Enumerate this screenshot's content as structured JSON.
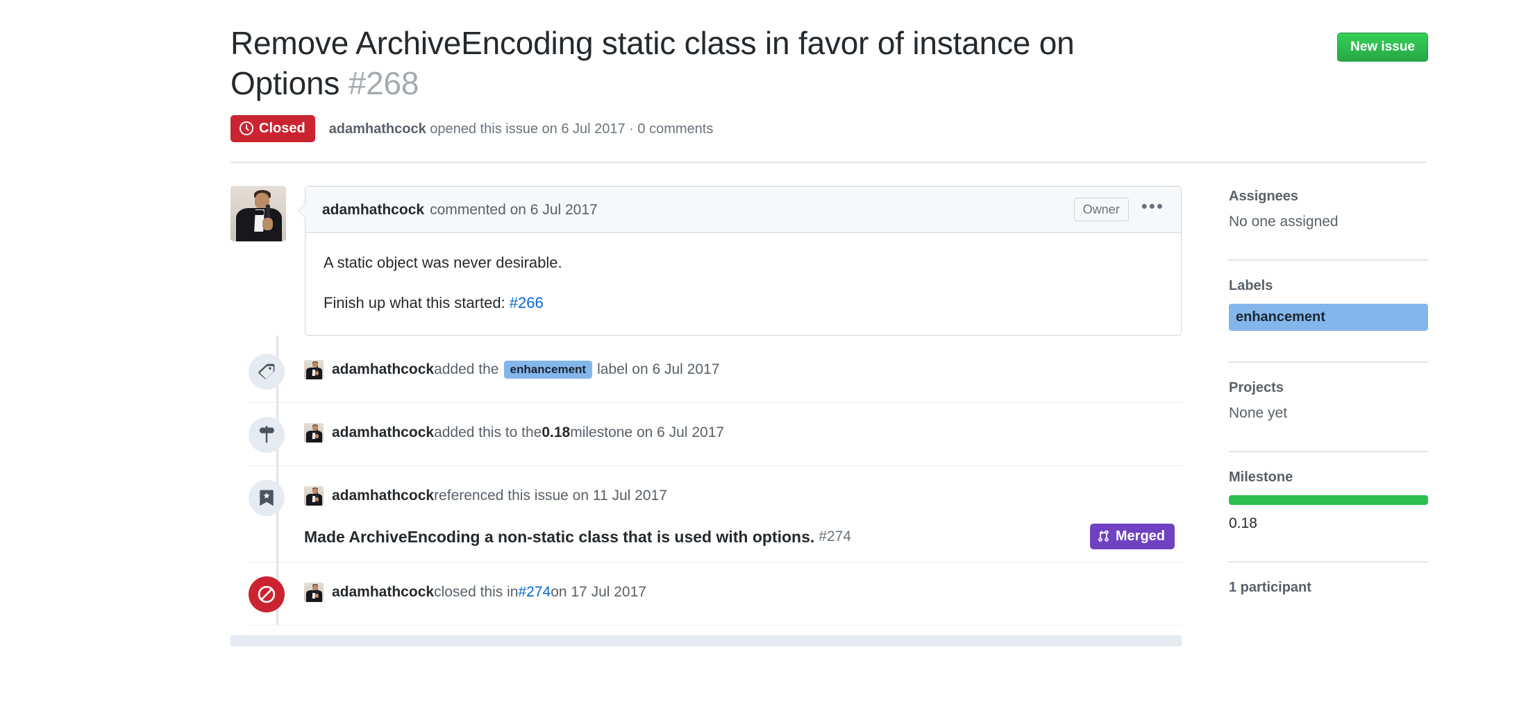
{
  "header": {
    "title": "Remove ArchiveEncoding static class in favor of instance on Options",
    "issue_number": "#268",
    "new_issue_button": "New issue",
    "state": "Closed",
    "state_color": "#cb2431",
    "meta_author": "adamhathcock",
    "meta_action": " opened this issue on 6 Jul 2017 · 0 comments"
  },
  "comment": {
    "author": "adamhathcock",
    "action": "commented on 6 Jul 2017",
    "role_badge": "Owner",
    "menu_icon": "kebab-horizontal-icon",
    "body_p1": "A static object was never desirable.",
    "body_p2_prefix": "Finish up what this started: ",
    "body_p2_link": "#266"
  },
  "timeline": [
    {
      "icon": "tag-icon",
      "author": "adamhathcock",
      "text_before": " added the ",
      "label": "enhancement",
      "text_after": " label on 6 Jul 2017"
    },
    {
      "icon": "milestone-icon",
      "author": "adamhathcock",
      "text_before": " added this to the ",
      "strong": "0.18",
      "text_after": " milestone on 6 Jul 2017"
    },
    {
      "icon": "bookmark-icon",
      "author": "adamhathcock",
      "text_before": " referenced this issue on 11 Jul 2017",
      "ref_title": "Made ArchiveEncoding a non-static class that is used with options.",
      "ref_number": "#274",
      "ref_state": "Merged",
      "ref_state_color": "#6f42c1",
      "ref_state_icon": "git-merge-icon"
    },
    {
      "icon": "issue-closed-icon",
      "author": "adamhathcock",
      "text_before": " closed this in ",
      "link": "#274",
      "text_after": " on 17 Jul 2017"
    }
  ],
  "sidebar": {
    "assignees_title": "Assignees",
    "assignees_value": "No one assigned",
    "labels_title": "Labels",
    "labels": [
      {
        "name": "enhancement",
        "color": "#84b6eb"
      }
    ],
    "projects_title": "Projects",
    "projects_value": "None yet",
    "milestone_title": "Milestone",
    "milestone_progress": 100,
    "milestone_color": "#2cbe4e",
    "milestone_name": "0.18",
    "participants_title": "1 participant"
  }
}
